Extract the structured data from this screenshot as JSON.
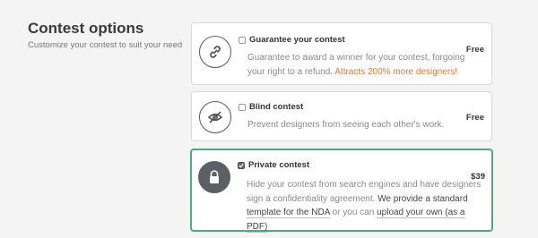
{
  "section": {
    "title": "Contest options",
    "subtitle": "Customize your contest to suit your need"
  },
  "options": [
    {
      "title": "Guarantee your contest",
      "icon": "link-icon",
      "checked": false,
      "price": "Free",
      "description": "Guarantee to award a winner for your contest, forgoing your right to a refund.",
      "highlight": "Attracts 200% more designers!"
    },
    {
      "title": "Blind contest",
      "icon": "eye-slash-icon",
      "checked": false,
      "price": "Free",
      "description": "Prevent designers from seeing each other's work."
    },
    {
      "title": "Private contest",
      "icon": "lock-icon",
      "checked": true,
      "price": "$39",
      "description": "Hide your contest from search engines and have designers sign a confidentiality agreement.",
      "nda_text_a": "We provide a standard",
      "nda_link": "template for the NDA",
      "nda_text_b": "or you can",
      "upload_link": "upload your own (as a PDF)"
    }
  ],
  "colors": {
    "accent_orange": "#e07a3c",
    "selected_border": "#4fa884"
  }
}
